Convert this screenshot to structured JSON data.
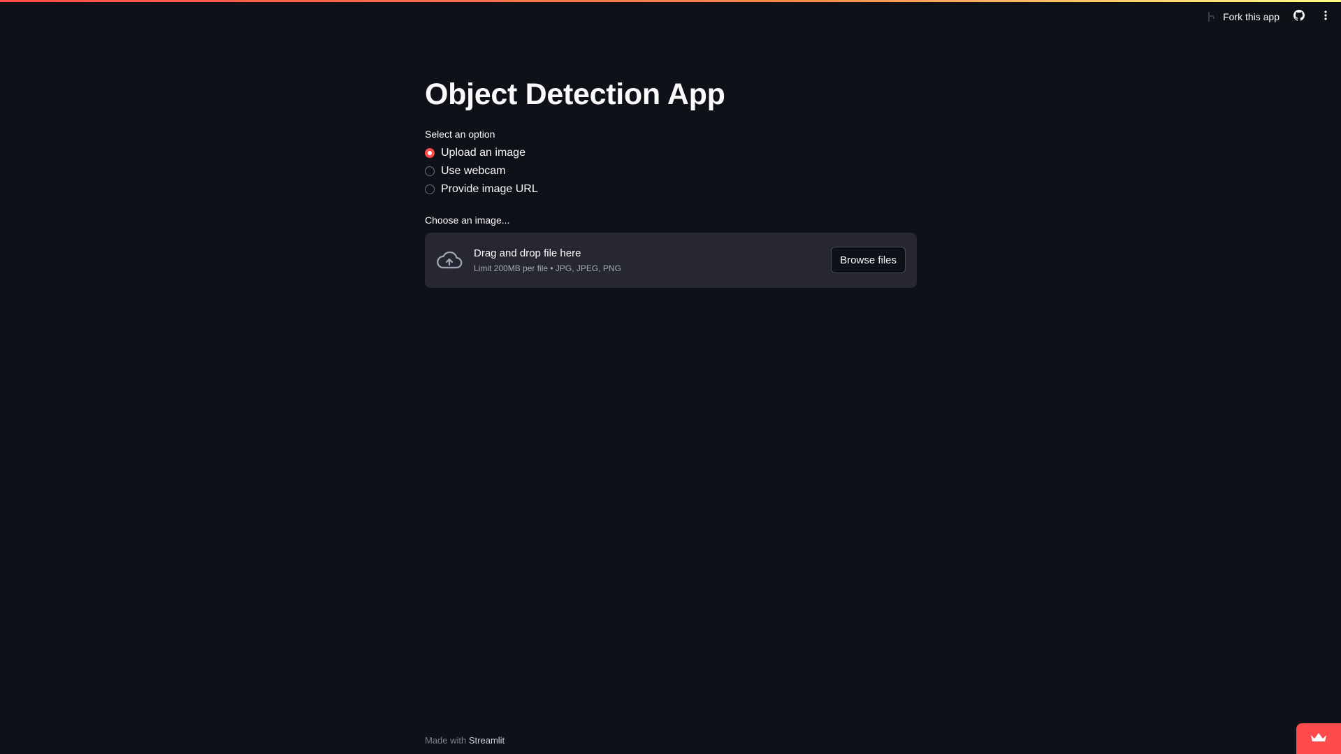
{
  "toolbar": {
    "fork_label": "Fork this app",
    "github_icon": "github-icon",
    "menu_icon": "kebab-menu-icon"
  },
  "main": {
    "title": "Object Detection App",
    "radio": {
      "label": "Select an option",
      "selected": "Upload an image",
      "options": [
        "Upload an image",
        "Use webcam",
        "Provide image URL"
      ]
    },
    "uploader": {
      "label": "Choose an image...",
      "instructions": "Drag and drop file here",
      "limit": "Limit 200MB per file • JPG, JPEG, PNG",
      "button": "Browse files",
      "icon": "cloud-upload-icon"
    }
  },
  "footer": {
    "prefix": "Made with",
    "brand": "Streamlit"
  },
  "badge": {
    "icon": "crown-icon"
  },
  "colors": {
    "background": "#0e1117",
    "accent": "#ff4b4b",
    "dropzone": "#262730",
    "text": "#fafafa"
  }
}
